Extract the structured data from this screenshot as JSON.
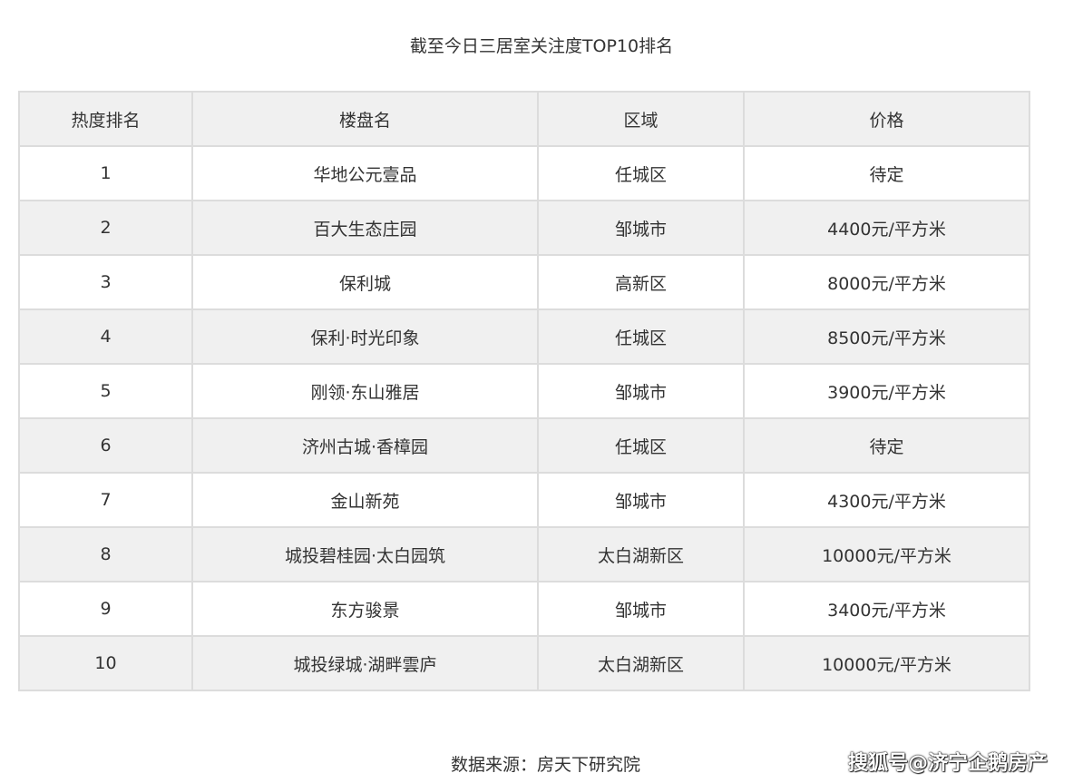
{
  "title": "截至今日三居室关注度TOP10排名",
  "table": {
    "headers": [
      "热度排名",
      "楼盘名",
      "区域",
      "价格"
    ],
    "rows": [
      [
        "1",
        "华地公元壹品",
        "任城区",
        "待定"
      ],
      [
        "2",
        "百大生态庄园",
        "邹城市",
        "4400元/平方米"
      ],
      [
        "3",
        "保利城",
        "高新区",
        "8000元/平方米"
      ],
      [
        "4",
        "保利·时光印象",
        "任城区",
        "8500元/平方米"
      ],
      [
        "5",
        "刚领·东山雅居",
        "邹城市",
        "3900元/平方米"
      ],
      [
        "6",
        "济州古城·香樟园",
        "任城区",
        "待定"
      ],
      [
        "7",
        "金山新苑",
        "邹城市",
        "4300元/平方米"
      ],
      [
        "8",
        "城投碧桂园·太白园筑",
        "太白湖新区",
        "10000元/平方米"
      ],
      [
        "9",
        "东方骏景",
        "邹城市",
        "3400元/平方米"
      ],
      [
        "10",
        "城投绿城·湖畔雲庐",
        "太白湖新区",
        "10000元/平方米"
      ]
    ]
  },
  "source": "数据来源：房天下研究院",
  "watermark": "搜狐号@济宁企鹅房产",
  "colors": {
    "header_bg": "#f0f0f0",
    "stripe_bg": "#f0f0f0",
    "border": "#dcdcdc",
    "text": "#333333"
  }
}
